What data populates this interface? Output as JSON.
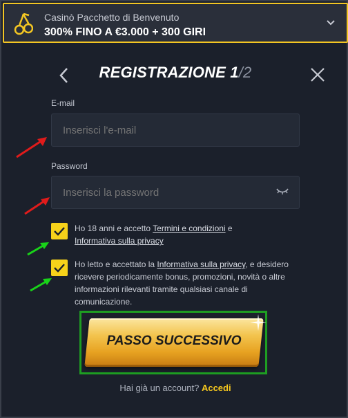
{
  "promo": {
    "subtitle": "Casinò Pacchetto di Benvenuto",
    "headline": "300% FINO A €3.000 + 300 GIRI"
  },
  "header": {
    "title": "REGISTRAZIONE 1",
    "step_total": "/2"
  },
  "form": {
    "email_label": "E-mail",
    "email_placeholder": "Inserisci l'e-mail",
    "password_label": "Password",
    "password_placeholder": "Inserisci la password"
  },
  "consents": {
    "age_prefix": "Ho 18 anni e accetto ",
    "terms_link": "Termini e condizioni",
    "age_mid": " e",
    "privacy_link": "Informativa sulla privacy",
    "marketing_prefix": "Ho letto e accettato la ",
    "marketing_link": "Informativa sulla privacy",
    "marketing_suffix": ", e desidero ricevere periodicamente bonus, promozioni, novità o altre informazioni rilevanti tramite qualsiasi canale di comunicazione.",
    "age_checked": true,
    "marketing_checked": true
  },
  "actions": {
    "next_label": "PASSO SUCCESSIVO",
    "have_account": "Hai già un account?",
    "login_label": "Accedi"
  },
  "colors": {
    "accent": "#f6c81e",
    "background": "#1b202b",
    "annotation_red": "#e01b1b",
    "annotation_green": "#19d319"
  },
  "icons": {
    "promo": "cherry-icon",
    "back": "chevron-left-icon",
    "close": "close-icon",
    "password_toggle": "eye-closed-icon"
  }
}
